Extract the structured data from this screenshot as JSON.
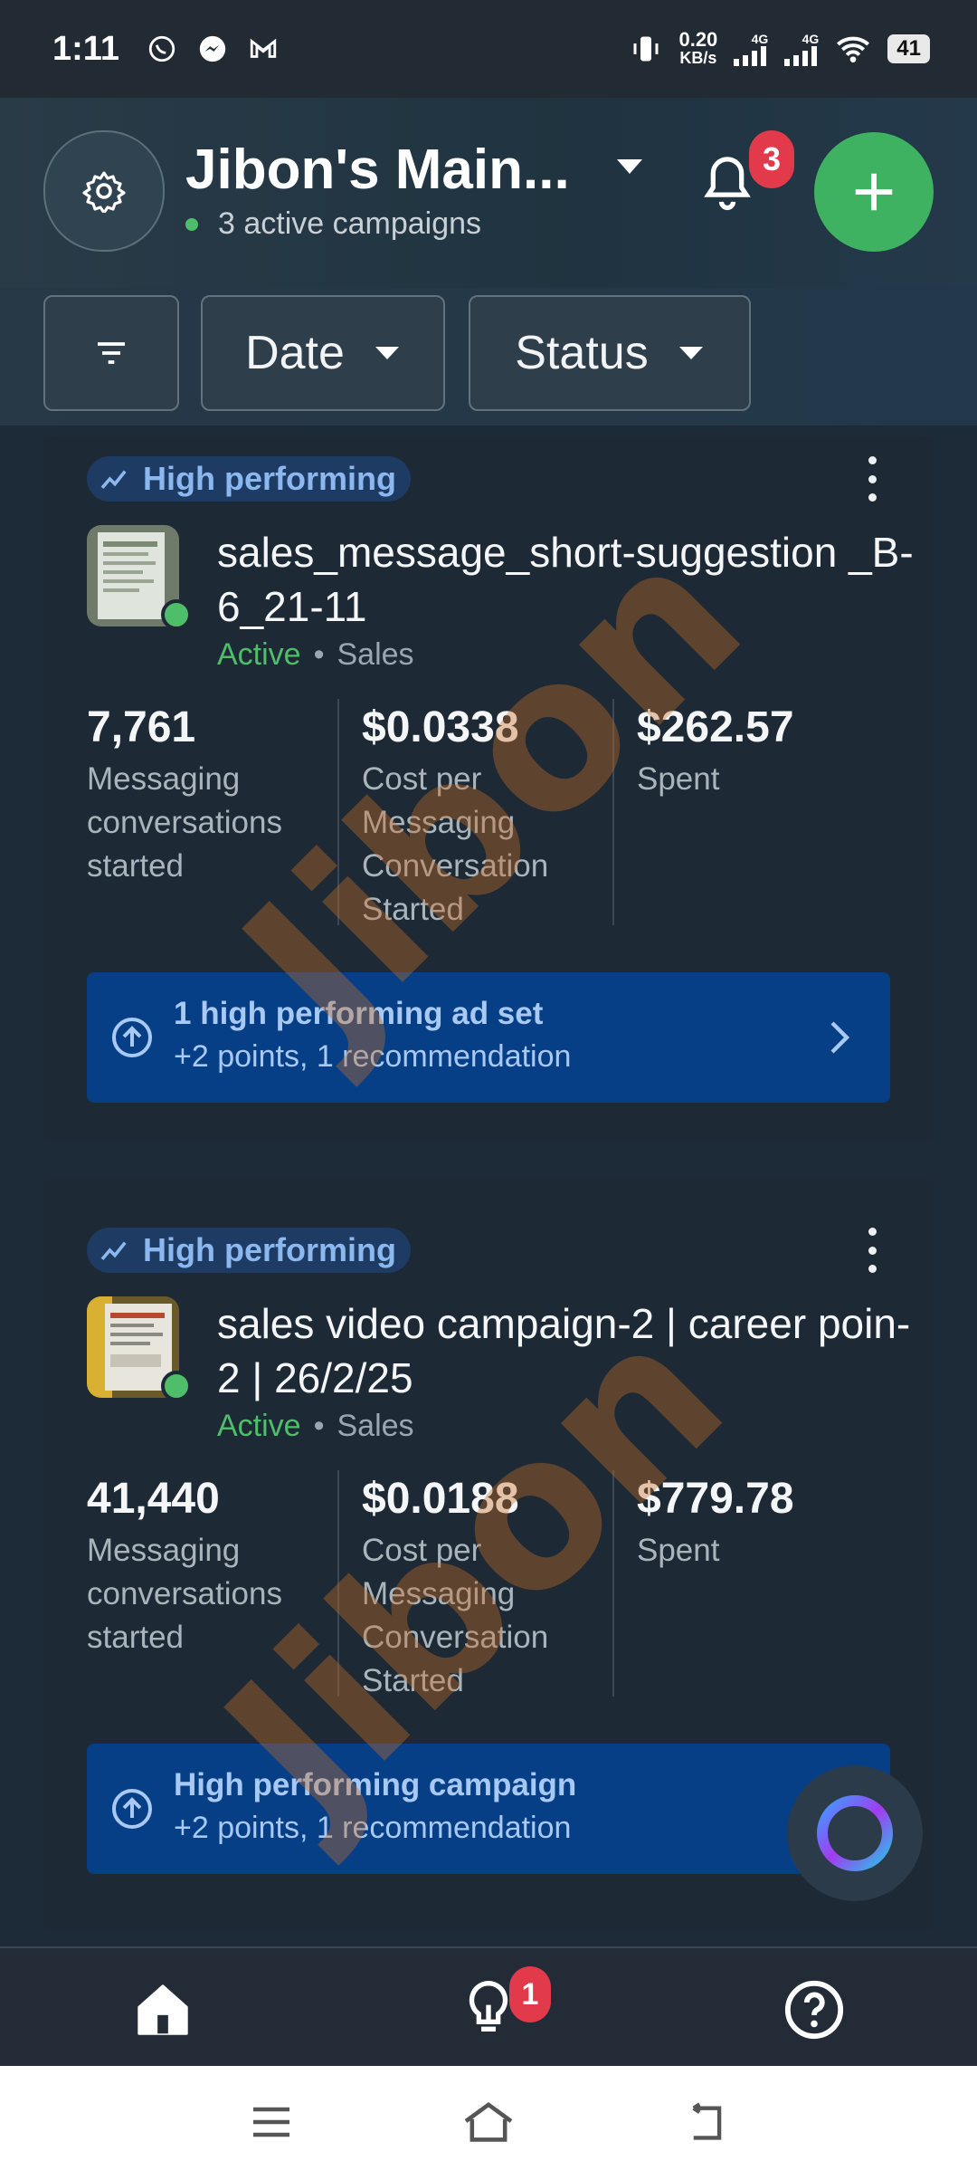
{
  "status_bar": {
    "time": "1:11",
    "net_speed": "0.20",
    "net_unit": "KB/s",
    "net1": "4G",
    "net2": "4G",
    "battery": "41"
  },
  "header": {
    "account_title": "Jibon's Main...",
    "active_campaigns": "3 active campaigns",
    "notification_count": "3"
  },
  "filters": {
    "date_label": "Date",
    "status_label": "Status"
  },
  "campaigns": [
    {
      "badge": "High performing",
      "name": "sales_message_short-suggestion _B-6_21-11",
      "status": "Active",
      "objective": "Sales",
      "metrics": [
        {
          "value": "7,761",
          "label": "Messaging conversations started"
        },
        {
          "value": "$0.0338",
          "label": "Cost per Messaging Conversation Started"
        },
        {
          "value": "$262.57",
          "label": "Spent"
        }
      ],
      "reco_title": "1 high performing ad set",
      "reco_sub": "+2 points, 1 recommendation"
    },
    {
      "badge": "High performing",
      "name": "sales video campaign-2 | career poin-2 | 26/2/25",
      "status": "Active",
      "objective": "Sales",
      "metrics": [
        {
          "value": "41,440",
          "label": "Messaging conversations started"
        },
        {
          "value": "$0.0188",
          "label": "Cost per Messaging Conversation Started"
        },
        {
          "value": "$779.78",
          "label": "Spent"
        }
      ],
      "reco_title": "High performing campaign",
      "reco_sub": "+2 points, 1 recommendation"
    }
  ],
  "watermark": "Jibon",
  "bottom_nav": {
    "ideas_badge": "1"
  },
  "colors": {
    "accent_green": "#3fb262",
    "badge_red": "#e23a4a",
    "reco_blue": "#063f86"
  }
}
